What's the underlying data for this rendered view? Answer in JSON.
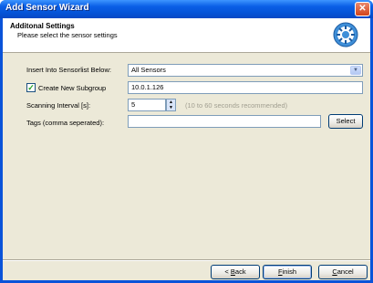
{
  "window": {
    "title": "Add Sensor Wizard",
    "close_glyph": "✕"
  },
  "header": {
    "title": "Additonal Settings",
    "subtitle": "Please select the sensor settings",
    "icon": "wizard-gear-icon"
  },
  "form": {
    "insert_label": "Insert Into Sensorlist Below:",
    "insert_value": "All Sensors",
    "subgroup_label": "Create New Subgroup",
    "subgroup_checked": true,
    "subgroup_value": "10.0.1.126",
    "interval_label": "Scanning Interval [s]:",
    "interval_value": "5",
    "interval_hint": "(10 to 60 seconds recommended)",
    "tags_label": "Tags (comma seperated):",
    "tags_value": "",
    "select_label": "Select"
  },
  "footer": {
    "back_prefix": "< ",
    "back_key": "B",
    "back_rest": "ack",
    "finish_key": "F",
    "finish_rest": "inish",
    "cancel_key": "C",
    "cancel_rest": "ancel"
  },
  "colors": {
    "titlebar": "#0554d8",
    "dialog_bg": "#ece9d8",
    "field_border": "#7f9db9"
  }
}
